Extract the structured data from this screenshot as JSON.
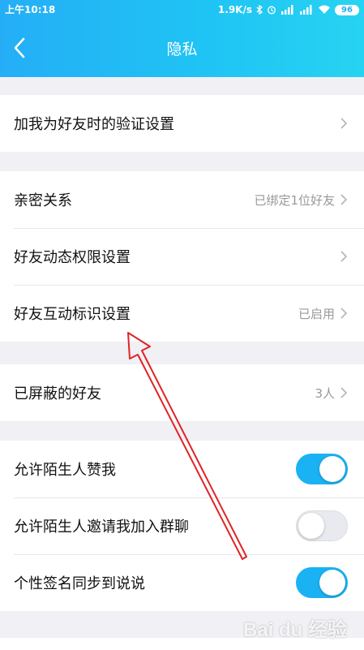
{
  "status_bar": {
    "time": "上午10:18",
    "speed": "1.9K/s",
    "battery": "96"
  },
  "nav": {
    "title": "隐私",
    "back_icon": "chevron-left-icon"
  },
  "groups": [
    {
      "rows": [
        {
          "label": "加我为好友时的验证设置",
          "value": ""
        }
      ]
    },
    {
      "rows": [
        {
          "label": "亲密关系",
          "value": "已绑定1位好友"
        },
        {
          "label": "好友动态权限设置",
          "value": ""
        },
        {
          "label": "好友互动标识设置",
          "value": "已启用"
        }
      ]
    },
    {
      "rows": [
        {
          "label": "已屏蔽的好友",
          "value": "3人"
        }
      ]
    },
    {
      "rows": [
        {
          "label": "允许陌生人赞我",
          "toggle": true
        },
        {
          "label": "允许陌生人邀请我加入群聊",
          "toggle": false
        },
        {
          "label": "个性签名同步到说说",
          "toggle": true
        }
      ]
    }
  ],
  "watermark": "Bai du 经验",
  "colors": {
    "header_start": "#25aef6",
    "header_end": "#27d3f2",
    "toggle_on": "#1ab2f3",
    "annotation_arrow": "#e02424"
  }
}
